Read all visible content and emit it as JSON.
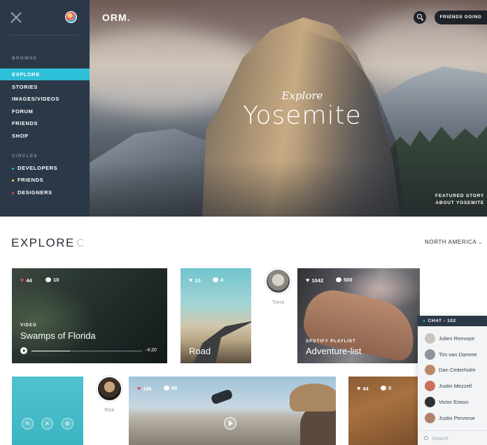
{
  "sidebar": {
    "browse_heading": "BROWSE",
    "items": [
      {
        "label": "EXPLORE",
        "active": true
      },
      {
        "label": "STORIES",
        "active": false
      },
      {
        "label": "IMAGES/VIDEOS",
        "active": false
      },
      {
        "label": "FORUM",
        "active": false
      },
      {
        "label": "FRIENDS",
        "active": false
      },
      {
        "label": "SHOP",
        "active": false
      }
    ],
    "circles_heading": "CIRCLES",
    "circles": [
      {
        "label": "DEVELOPERS",
        "color": "#2ebfd9"
      },
      {
        "label": "FRIENDS",
        "color": "#f2c94c"
      },
      {
        "label": "DESIGNERS",
        "color": "#e94b4b"
      }
    ]
  },
  "header": {
    "logo": "ORM.",
    "friends_button": "FRIENDS GOING"
  },
  "hero": {
    "subtitle": "Explore",
    "title": "Yosemite",
    "featured_line1": "FEATURED STORY",
    "featured_line2": "ABOUT YOSEMITE"
  },
  "explore": {
    "title": "EXPLORE",
    "region": "NORTH AMERICA",
    "region_chevron": "⌄"
  },
  "cards": {
    "swamps": {
      "likes": "44",
      "comments": "10",
      "kicker": "VIDEO",
      "title": "Swamps of Florida",
      "time": "-4:20",
      "progress": 0.35
    },
    "road": {
      "likes": "10",
      "comments": "4",
      "title": "Road"
    },
    "trent": {
      "name": "Trent"
    },
    "adventure": {
      "likes": "1042",
      "comments": "500",
      "kicker": "SPOTIFY PLAYLIST",
      "title": "Adventure-list"
    },
    "rick": {
      "name": "Rick"
    },
    "skate": {
      "likes": "10k",
      "comments": "88"
    },
    "wood": {
      "likes": "44",
      "comments": "0"
    }
  },
  "chat": {
    "title": "CHAT - 102",
    "users": [
      {
        "name": "Julien Renvoye",
        "color": "#c9c4bd"
      },
      {
        "name": "Tim van Damme",
        "color": "#8e949b"
      },
      {
        "name": "Dan Cederholm",
        "color": "#b98a6a"
      },
      {
        "name": "Justin Mezzell",
        "color": "#c96f5a"
      },
      {
        "name": "Victor Erixon",
        "color": "#2c2f33"
      },
      {
        "name": "Justin Pervorse",
        "color": "#b0826a"
      }
    ],
    "search_placeholder": "Search"
  },
  "colors": {
    "accent": "#2ebfd9",
    "like": "#e94b4b",
    "sidebar_bg": "#2b3848"
  }
}
